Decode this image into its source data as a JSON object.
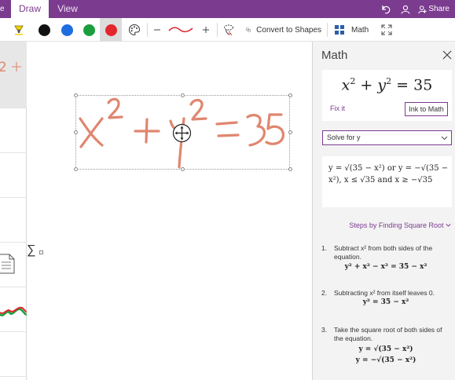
{
  "tabs": {
    "edge": "e",
    "draw": "Draw",
    "view": "View"
  },
  "titlebar": {
    "share_label": "Share",
    "icons": [
      "undo-icon",
      "person-icon",
      "share-icon"
    ]
  },
  "ribbon": {
    "tools": [
      "highlighter-pen-icon",
      "black-pen",
      "blue-pen",
      "green-pen",
      "red-pen",
      "palette-icon",
      "thinner-stroke",
      "thicker-stroke",
      "lasso-icon"
    ],
    "pen_colors": {
      "black": "#111111",
      "blue": "#1f6ee0",
      "green": "#1a9e3c",
      "red": "#e3262b"
    },
    "convert_label": "Convert to Shapes",
    "math_label": "Math",
    "accent": "#7b3b8f"
  },
  "canvas": {
    "ink_expression": "x² + y² = 35",
    "ink_color": "#e0866f",
    "sigma": "∑"
  },
  "math_panel": {
    "title": "Math",
    "equation": {
      "x": "x",
      "y": "y",
      "exp": "2",
      "plus": "+",
      "eq": "=",
      "value": "35"
    },
    "fix_it": "Fix it",
    "ink_to_math": "Ink to Math",
    "solve_option": "Solve for y",
    "solution": "y = √(35 − x²) or y = −√(35 − x²), x ≤ √35 and x ≥ −√35",
    "steps_link": "Steps by Finding Square Root",
    "steps": [
      {
        "num": "1.",
        "text": "Subtract x² from both sides of the equation.",
        "math": "y² + x² − x² = 35 − x²"
      },
      {
        "num": "2.",
        "text": "Subtracting x² from itself leaves 0.",
        "math": "y² = 35 − x²"
      },
      {
        "num": "3.",
        "text": "Take the square root of both sides of the equation.",
        "math": "y = √(35 − x²)",
        "math2": "y = −√(35 − x²)"
      }
    ]
  }
}
